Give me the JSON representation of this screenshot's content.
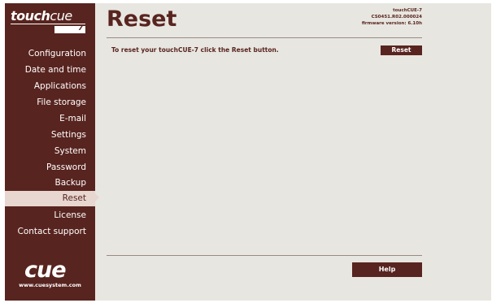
{
  "brand": {
    "logo_bold": "touch",
    "logo_light": "cue",
    "logo_model": "7",
    "footer_logo": "cue",
    "footer_url": "www.cuesystem.com"
  },
  "device": {
    "name": "touchCUE-7",
    "serial": "CS0451.R02.000024",
    "firmware": "firmware version: 6.10h"
  },
  "sidebar": {
    "items": [
      {
        "label": "Configuration",
        "active": false
      },
      {
        "label": "Date and time",
        "active": false
      },
      {
        "label": "Applications",
        "active": false
      },
      {
        "label": "File storage",
        "active": false
      },
      {
        "label": "E-mail",
        "active": false
      },
      {
        "label": "Settings",
        "active": false
      },
      {
        "label": "System",
        "active": false
      },
      {
        "label": "Password",
        "active": false
      },
      {
        "label": "Backup",
        "active": false
      },
      {
        "label": "Reset",
        "active": true
      },
      {
        "label": "License",
        "active": false
      },
      {
        "label": "Contact support",
        "active": false
      }
    ]
  },
  "main": {
    "title": "Reset",
    "instruction": "To reset your touchCUE-7 click the Reset button.",
    "reset_label": "Reset",
    "help_label": "Help"
  },
  "colors": {
    "brand_maroon": "#58241f",
    "active_item_bg": "#e8d6d0",
    "content_bg": "#e8e6e0"
  }
}
